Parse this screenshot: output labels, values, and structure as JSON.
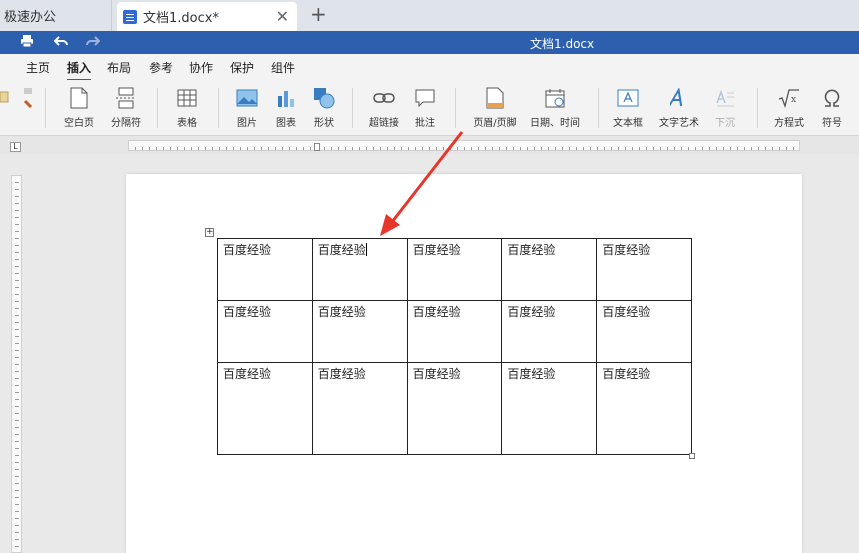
{
  "tabs": {
    "app_label": "极速办公",
    "doc_label": "文档1.docx*",
    "close_glyph": "✕",
    "add_glyph": "+"
  },
  "titlebar": {
    "title": "文档1.docx"
  },
  "menu": {
    "items": [
      "主页",
      "插入",
      "布局",
      "参考",
      "协作",
      "保护",
      "组件"
    ],
    "active": "插入"
  },
  "ribbon": {
    "blank_page": "空白页",
    "page_break": "分隔符",
    "table": "表格",
    "image": "图片",
    "chart": "图表",
    "shape": "形状",
    "hyperlink": "超链接",
    "comment": "批注",
    "header_footer": "页眉/页脚",
    "date_time": "日期、时间",
    "text_box": "文本框",
    "word_art": "文字艺术",
    "drop_cap": "下沉",
    "equation": "方程式",
    "symbol": "符号"
  },
  "table": {
    "rows": [
      [
        "百度经验",
        "百度经验",
        "百度经验",
        "百度经验",
        "百度经验"
      ],
      [
        "百度经验",
        "百度经验",
        "百度经验",
        "百度经验",
        "百度经验"
      ],
      [
        "百度经验",
        "百度经验",
        "百度经验",
        "百度经验",
        "百度经验"
      ]
    ]
  },
  "colors": {
    "accent": "#2c5fae",
    "arrow": "#e8352b"
  }
}
